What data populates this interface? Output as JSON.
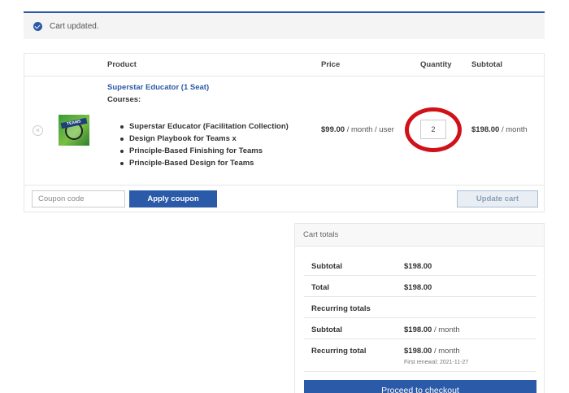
{
  "notice": {
    "icon": "check-circle-icon",
    "message": "Cart updated."
  },
  "cart": {
    "headers": {
      "product": "Product",
      "price": "Price",
      "quantity": "Quantity",
      "subtotal": "Subtotal"
    },
    "item": {
      "name": "Superstar Educator (1 Seat)",
      "courses_label": "Courses:",
      "courses": [
        "Superstar Educator (Facilitation Collection)",
        "Design Playbook for Teams x",
        "Principle-Based Finishing for Teams",
        "Principle-Based Design for Teams"
      ],
      "thumb_text": "TEAMS",
      "price_amount": "$99.00",
      "price_unit": " / month / user",
      "quantity": "2",
      "subtotal_amount": "$198.00",
      "subtotal_unit": " / month"
    },
    "coupon_placeholder": "Coupon code",
    "apply_label": "Apply coupon",
    "update_label": "Update cart"
  },
  "totals": {
    "title": "Cart totals",
    "rows": [
      {
        "label": "Subtotal",
        "amount": "$198.00",
        "unit": ""
      },
      {
        "label": "Total",
        "amount": "$198.00",
        "unit": ""
      },
      {
        "label": "Recurring totals",
        "amount": "",
        "unit": ""
      },
      {
        "label": "Subtotal",
        "amount": "$198.00",
        "unit": " / month"
      },
      {
        "label": "Recurring total",
        "amount": "$198.00",
        "unit": " / month",
        "note": "First renewal: 2021-11-27"
      }
    ],
    "checkout_label": "Proceed to checkout"
  },
  "colors": {
    "accent": "#2a5aa8",
    "highlight_ring": "#d01218"
  }
}
